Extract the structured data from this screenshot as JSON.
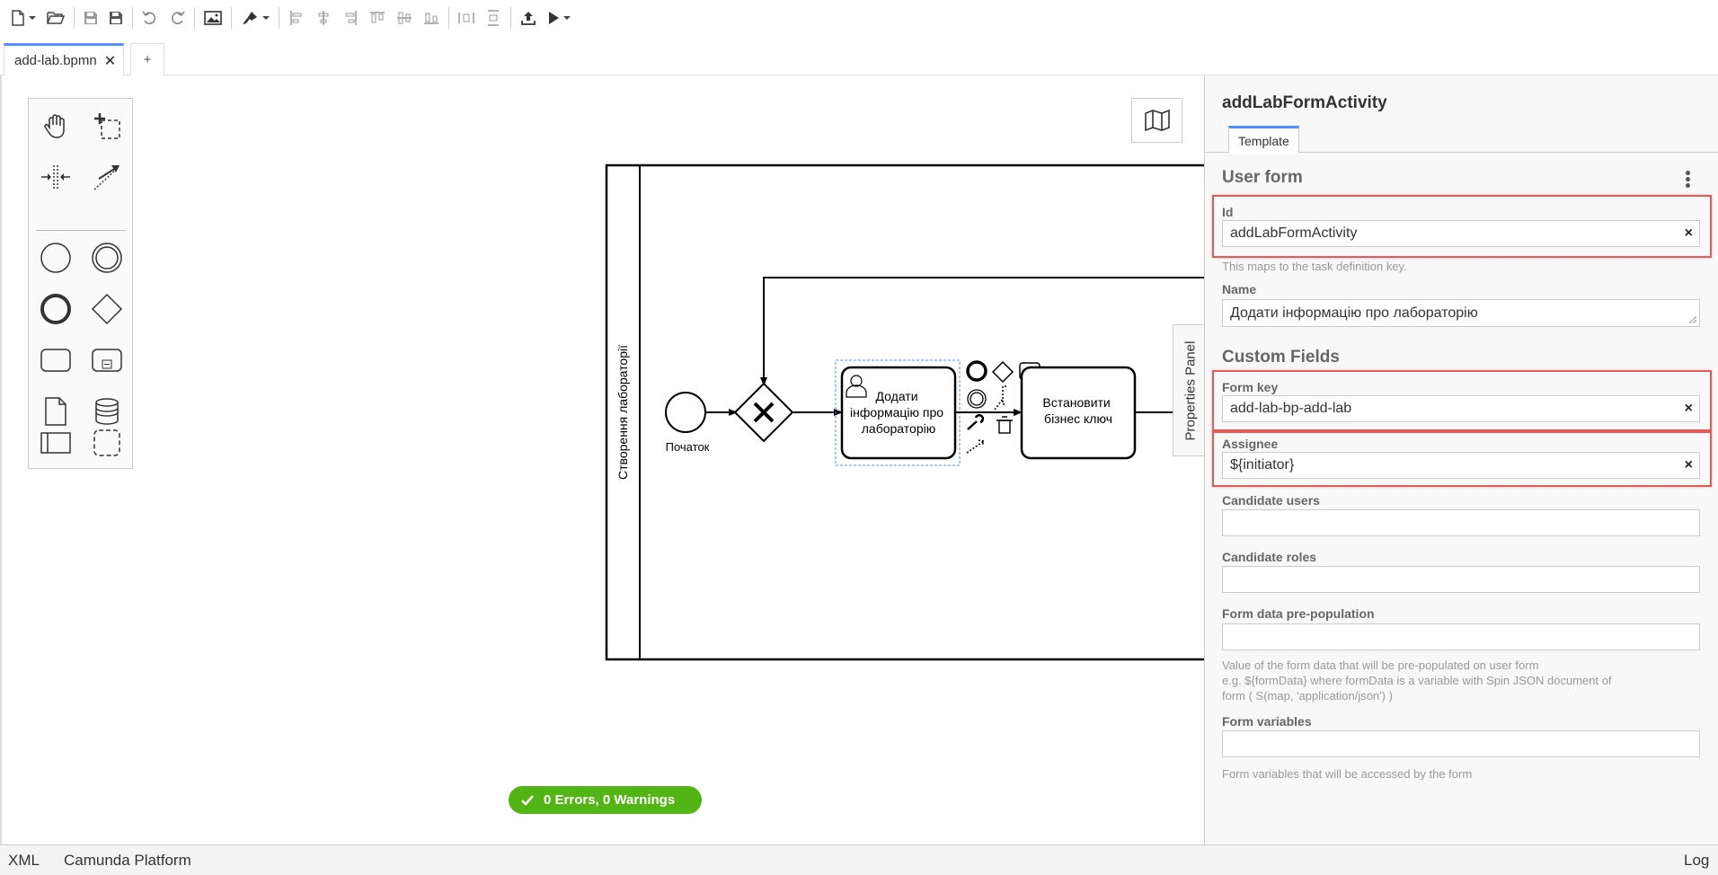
{
  "tabs": {
    "active_label": "add-lab.bpmn",
    "close_glyph": "✕",
    "add_label": "+"
  },
  "toolbar": {
    "icons": [
      "new-file-icon",
      "open-file-icon",
      "save-icon",
      "save-as-icon",
      "undo-icon",
      "redo-icon",
      "export-image-icon",
      "color-picker-icon",
      "align-left-icon",
      "align-center-icon",
      "align-right-icon",
      "align-top-icon",
      "align-middle-icon",
      "align-bottom-icon",
      "distribute-horizontal-icon",
      "distribute-vertical-icon",
      "deploy-icon",
      "run-icon"
    ]
  },
  "diagram": {
    "lane_label": "Створення лабораторії",
    "start_label": "Початок",
    "task1_lines": [
      "Додати",
      "інформацію про",
      "лабораторію"
    ],
    "task2_lines": [
      "Встановити",
      "бізнес ключ"
    ]
  },
  "status": {
    "text": "0 Errors, 0 Warnings",
    "color": "#52b415"
  },
  "props_toggle_label": "Properties Panel",
  "properties": {
    "element_title": "addLabFormActivity",
    "tab_label": "Template",
    "group_user_form": "User form",
    "id_label": "Id",
    "id_value": "addLabFormActivity",
    "id_hint": "This maps to the task definition key.",
    "name_label": "Name",
    "name_value": "Додати інформацію про лабораторію",
    "group_custom_fields": "Custom Fields",
    "form_key_label": "Form key",
    "form_key_value": "add-lab-bp-add-lab",
    "assignee_label": "Assignee",
    "assignee_value": "${initiator}",
    "candidate_users_label": "Candidate users",
    "candidate_users_value": "",
    "candidate_roles_label": "Candidate roles",
    "candidate_roles_value": "",
    "prepop_label": "Form data pre-population",
    "prepop_value": "",
    "prepop_hint_1": "Value of the form data that will be pre-populated on user form",
    "prepop_hint_2": "e.g. ${formData} where formData is a variable with Spin JSON document of",
    "prepop_hint_3": "form ( S(map, 'application/json') )",
    "form_vars_label": "Form variables",
    "form_vars_value": "",
    "form_vars_hint": "Form variables that will be accessed by the form",
    "clear_glyph": "×"
  },
  "footer": {
    "xml": "XML",
    "platform": "Camunda Platform",
    "log": "Log"
  },
  "colors": {
    "accent": "#4d90fe",
    "highlight": "#e35b5b",
    "success": "#52b415"
  }
}
